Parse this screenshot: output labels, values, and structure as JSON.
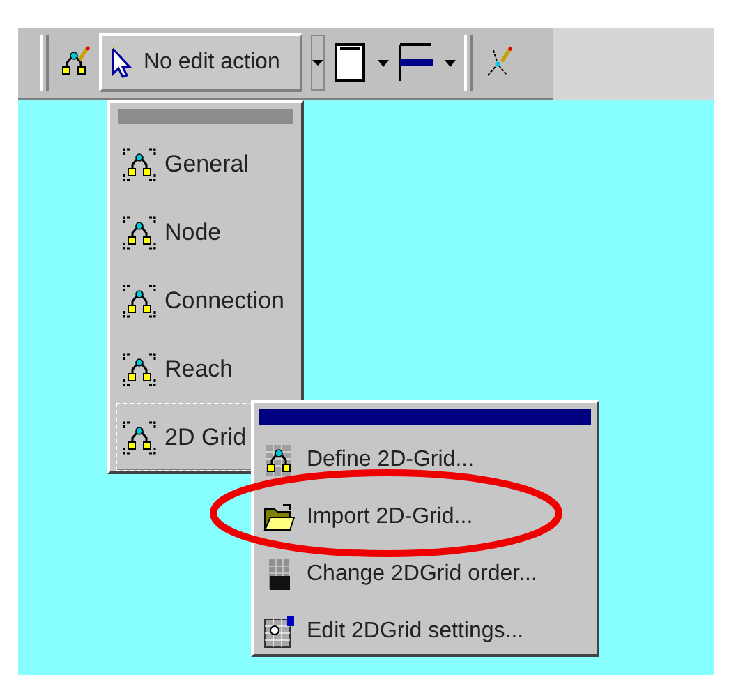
{
  "toolbar": {
    "edit_action": "No edit action"
  },
  "edit_menu": {
    "items": [
      {
        "label": "General",
        "selected": false
      },
      {
        "label": "Node",
        "selected": false
      },
      {
        "label": "Connection",
        "selected": false
      },
      {
        "label": "Reach",
        "selected": false
      },
      {
        "label": "2D Grid",
        "selected": true
      }
    ]
  },
  "grid_submenu": {
    "items": [
      {
        "label": "Define 2D-Grid...",
        "kind": "grid",
        "circled": false
      },
      {
        "label": "Import 2D-Grid...",
        "kind": "folder",
        "circled": true
      },
      {
        "label": "Change 2DGrid order...",
        "kind": "order",
        "circled": false
      },
      {
        "label": "Edit 2DGrid settings...",
        "kind": "settings",
        "circled": false
      }
    ]
  }
}
